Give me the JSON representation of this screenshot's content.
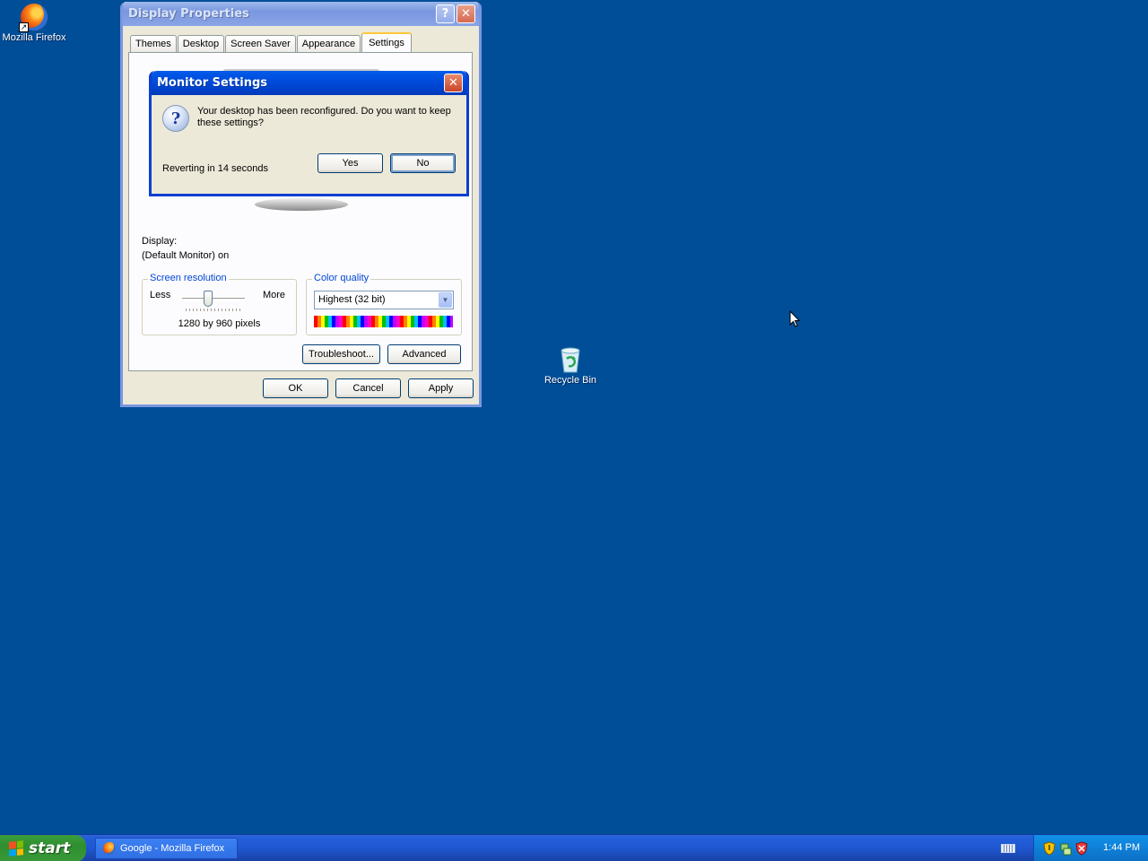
{
  "desktop": {
    "icons": [
      {
        "label": "Mozilla Firefox"
      },
      {
        "label": "Recycle Bin"
      }
    ]
  },
  "display_properties": {
    "title": "Display Properties",
    "tabs": [
      "Themes",
      "Desktop",
      "Screen Saver",
      "Appearance",
      "Settings"
    ],
    "selected_tab": "Settings",
    "display_label": "Display:",
    "display_value": "(Default Monitor) on",
    "screen_resolution": {
      "legend": "Screen resolution",
      "less": "Less",
      "more": "More",
      "value_text": "1280 by 960 pixels"
    },
    "color_quality": {
      "legend": "Color quality",
      "selected": "Highest (32 bit)"
    },
    "buttons": {
      "troubleshoot": "Troubleshoot...",
      "advanced": "Advanced",
      "ok": "OK",
      "cancel": "Cancel",
      "apply": "Apply"
    }
  },
  "monitor_settings": {
    "title": "Monitor Settings",
    "message": "Your desktop has been reconfigured.  Do you want to keep these settings?",
    "countdown": "Reverting in 14 seconds",
    "yes": "Yes",
    "no": "No"
  },
  "taskbar": {
    "start_label": "start",
    "task_label": "Google - Mozilla Firefox",
    "clock": "1:44 PM"
  }
}
